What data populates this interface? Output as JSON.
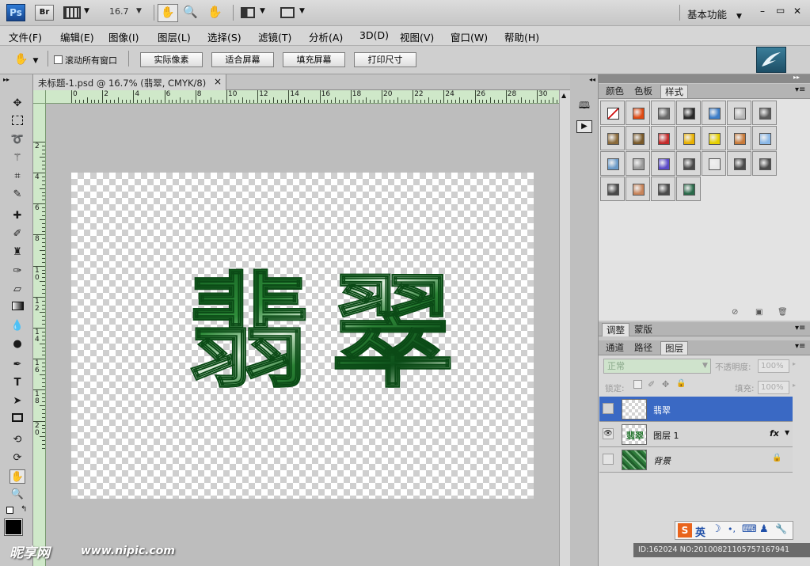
{
  "appbar": {
    "ps_logo": "Ps",
    "br_logo": "Br",
    "zoom_value": "16.7",
    "workspace_label": "基本功能",
    "window_min": "–",
    "window_restore": "▭",
    "window_close": "✕"
  },
  "menu": [
    "文件(F)",
    "编辑(E)",
    "图像(I)",
    "图层(L)",
    "选择(S)",
    "滤镜(T)",
    "分析(A)",
    "3D(D)",
    "视图(V)",
    "窗口(W)",
    "帮助(H)"
  ],
  "options": {
    "scroll_all_label": "滚动所有窗口",
    "buttons": [
      "实际像素",
      "适合屏幕",
      "填充屏幕",
      "打印尺寸"
    ]
  },
  "document": {
    "tab_title": "未标题-1.psd @ 16.7% (翡翠, CMYK/8)",
    "close_glyph": "×",
    "canvas_text": "翡翠",
    "ruler_top_labels": [
      "0",
      "2",
      "4",
      "6",
      "8",
      "10",
      "12",
      "14",
      "16",
      "18",
      "20",
      "22",
      "24",
      "26",
      "28",
      "30"
    ],
    "ruler_left_labels": [
      "2",
      "4",
      "6",
      "8",
      "10",
      "12",
      "14",
      "16",
      "18",
      "20"
    ]
  },
  "panels": {
    "top_tabs": [
      "颜色",
      "色板",
      "样式"
    ],
    "mid_tabs": [
      "调整",
      "蒙版"
    ],
    "layer_tabs": [
      "通道",
      "路径",
      "图层"
    ],
    "blend_mode": "正常",
    "opacity_label": "不透明度:",
    "opacity_value": "100%",
    "lock_label": "锁定:",
    "fill_label": "填充:",
    "fill_value": "100%",
    "layers": [
      {
        "name": "翡翠",
        "visible": false,
        "selected": true,
        "fx": "",
        "lock": ""
      },
      {
        "name": "图层 1",
        "visible": true,
        "selected": false,
        "fx": "fx",
        "lock": ""
      },
      {
        "name": "背景",
        "visible": false,
        "selected": false,
        "fx": "",
        "lock": "🔒"
      }
    ],
    "style_colors": [
      "#ffffff",
      "#e04a12",
      "#6a6a6a",
      "#2a2a2a",
      "#3d7ec9",
      "#b8b8b8",
      "#5a5a5a",
      "#8a6a3a",
      "#7a5a2a",
      "#c42a2a",
      "#e8b000",
      "#e6d000",
      "#c87a3a",
      "#8ab8e8",
      "#6a9ac8",
      "#9a9a9a",
      "#5a4ac8",
      "#4a4a4a",
      "#e8e8e8",
      "#4a4a4a",
      "#4a4a4a",
      "#4a4a4a",
      "#c8845a",
      "#4a4a4a",
      "#2a6a4a"
    ]
  },
  "ime": {
    "s_logo": "S",
    "lang": "英",
    "moon": "☽",
    "dots": "•,",
    "keyboard": "⌨",
    "person": "♟",
    "wrench": "🔧"
  },
  "watermark": {
    "site": "www.nipic.com",
    "logo": "昵享网",
    "id_text": "ID:162024 NO:20100821105757167941"
  }
}
